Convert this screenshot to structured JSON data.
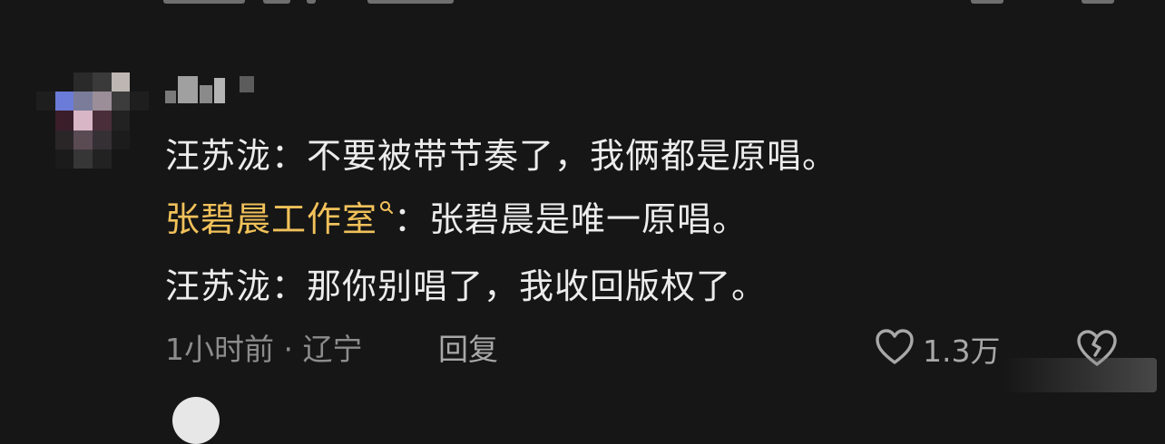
{
  "comment": {
    "lines": [
      {
        "speaker": "汪苏泷",
        "separator": "：",
        "text": "不要被带节奏了，我俩都是原唱。"
      },
      {
        "speaker": "张碧晨工作室",
        "separator": "：",
        "text": "张碧晨是唯一原唱。"
      },
      {
        "speaker": "汪苏泷",
        "separator": "：",
        "text": "那你别唱了，我收回版权了。"
      }
    ],
    "time": "1小时前",
    "dot": "·",
    "location": "辽宁",
    "reply_label": "回复",
    "like_count": "1.3万"
  },
  "colors": {
    "background": "#161616",
    "text": "#ececec",
    "highlight": "#f1c15a",
    "meta": "#8c8c8c"
  },
  "icons": {
    "like": "heart-outline-icon",
    "dislike": "broken-heart-outline-icon",
    "search_hint": "search-icon"
  }
}
